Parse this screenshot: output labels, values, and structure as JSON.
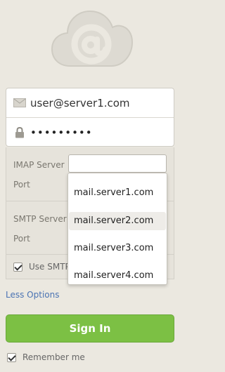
{
  "credentials": {
    "email": "user@server1.com",
    "password_mask": "•••••••••"
  },
  "options": {
    "imap_server_label": "IMAP Server",
    "imap_port_label": "Port",
    "imap_server_value": "",
    "smtp_server_label": "SMTP Server",
    "smtp_port_label": "Port",
    "use_smtp_label": "Use SMTP",
    "use_smtp_checked": true
  },
  "dropdown": {
    "items": [
      "mail.server1.com",
      "mail.server2.com",
      "mail.server3.com",
      "mail.server4.com"
    ],
    "highlighted_index": 1
  },
  "less_options_label": "Less Options",
  "sign_in_label": "Sign In",
  "remember_me": {
    "label": "Remember me",
    "checked": true
  },
  "colors": {
    "background": "#ebe8e0",
    "accent_green": "#7cc044",
    "link_blue": "#4a73b3"
  },
  "icons": {
    "logo": "cloud-at-icon",
    "email": "envelope-icon",
    "password": "lock-icon",
    "checkbox": "check-icon"
  }
}
